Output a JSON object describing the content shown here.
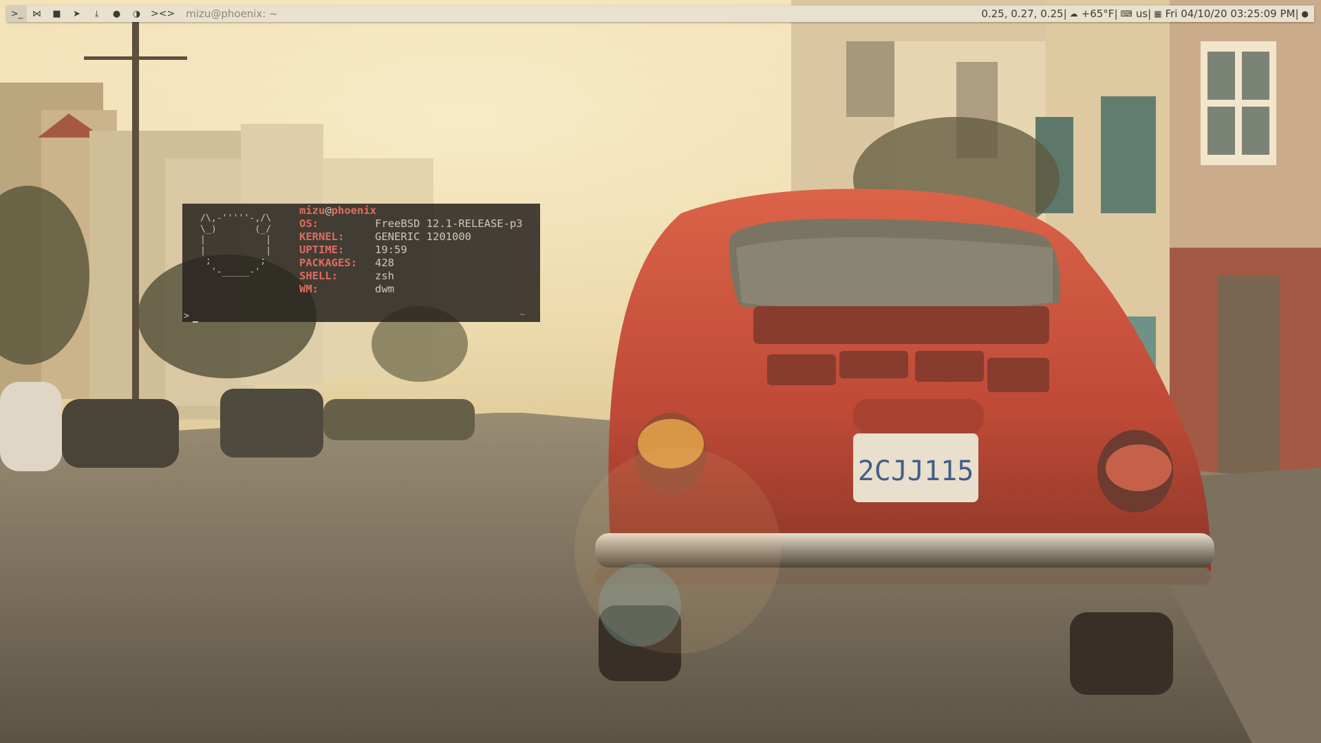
{
  "topbar": {
    "tags": [
      {
        "icon": "terminal-icon",
        "glyph": ">_",
        "selected": true
      },
      {
        "icon": "vscode-icon",
        "glyph": "⋈",
        "selected": false
      },
      {
        "icon": "folder-icon",
        "glyph": "■",
        "selected": false
      },
      {
        "icon": "telegram-icon",
        "glyph": "➤",
        "selected": false
      },
      {
        "icon": "download-icon",
        "glyph": "⤓",
        "selected": false
      },
      {
        "icon": "globe-icon",
        "glyph": "●",
        "selected": false
      },
      {
        "icon": "firefox-icon",
        "glyph": "◑",
        "selected": false
      }
    ],
    "layout_symbol": "><>",
    "window_title": "mizu@phoenix: ~",
    "status": {
      "load": "0.25, 0.27, 0.25|",
      "weather_icon": "weather-icon",
      "weather": "+65°F|",
      "keyboard_icon": "keyboard-icon",
      "keyboard": "us|",
      "calendar_icon": "calendar-icon",
      "datetime": "Fri 04/10/20 03:25:09 PM|",
      "power_icon": "freebsd-icon"
    }
  },
  "terminal": {
    "user": "mizu",
    "at": "@",
    "host": "phoenix",
    "ascii_logo": " /\\,-'''''-,/\\\n \\_)       (_/\n |           |\n |           |\n  ;         ;\n   '-_____-'",
    "info": [
      {
        "key": "OS:",
        "value": "FreeBSD 12.1-RELEASE-p3"
      },
      {
        "key": "KERNEL:",
        "value": "GENERIC 1201000"
      },
      {
        "key": "UPTIME:",
        "value": "19:59"
      },
      {
        "key": "PACKAGES:",
        "value": "428"
      },
      {
        "key": "SHELL:",
        "value": "zsh"
      },
      {
        "key": "WM:",
        "value": "dwm"
      }
    ],
    "prompt": ">",
    "cwd_indicator": "~"
  },
  "colors": {
    "bar_bg": "#e8e1d0",
    "terminal_bg": "#282420",
    "accent_red": "#e06c5e"
  }
}
